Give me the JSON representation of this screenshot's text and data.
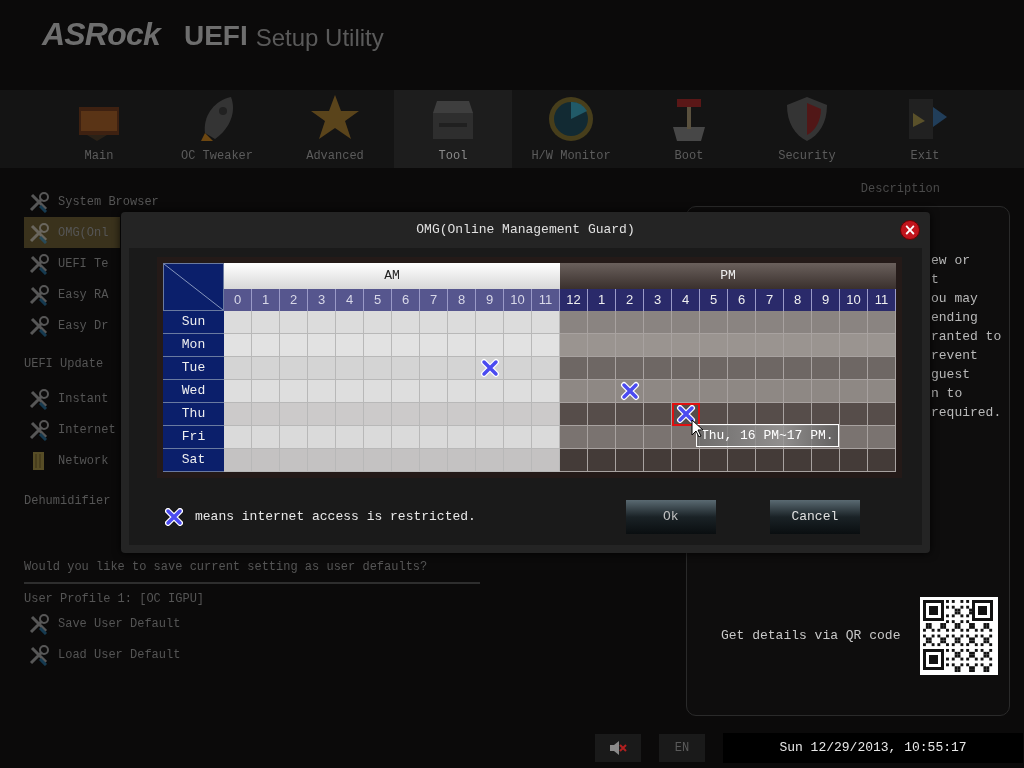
{
  "header": {
    "brand": "ASRock",
    "product": "UEFI",
    "subtitle": "Setup Utility"
  },
  "nav": [
    {
      "label": "Main",
      "kind": "main",
      "selected": false
    },
    {
      "label": "OC Tweaker",
      "kind": "oc",
      "selected": false
    },
    {
      "label": "Advanced",
      "kind": "advanced",
      "selected": false
    },
    {
      "label": "Tool",
      "kind": "tool",
      "selected": true
    },
    {
      "label": "H/W Monitor",
      "kind": "monitor",
      "selected": false
    },
    {
      "label": "Boot",
      "kind": "boot",
      "selected": false
    },
    {
      "label": "Security",
      "kind": "security",
      "selected": false
    },
    {
      "label": "Exit",
      "kind": "exit",
      "selected": false
    }
  ],
  "sidebar": {
    "items": [
      {
        "kind": "tool",
        "label": "System Browser",
        "selected": false
      },
      {
        "kind": "tool",
        "label": "OMG(Onl",
        "selected": true
      },
      {
        "kind": "tool",
        "label": "UEFI Te",
        "selected": false
      },
      {
        "kind": "tool",
        "label": "Easy RA",
        "selected": false
      },
      {
        "kind": "tool",
        "label": "Easy Dr",
        "selected": false
      },
      {
        "kind": "section",
        "label": "UEFI Update"
      },
      {
        "kind": "tool",
        "label": "Instant",
        "selected": false
      },
      {
        "kind": "tool",
        "label": "Internet",
        "selected": false
      },
      {
        "kind": "folder",
        "label": "Network",
        "selected": false
      },
      {
        "kind": "section",
        "label": "Dehumidifier"
      },
      {
        "kind": "question",
        "label": "Would you like to save current setting as user defaults?"
      },
      {
        "kind": "section",
        "label": "User Profile 1: [OC IGPU]"
      },
      {
        "kind": "tool",
        "label": "Save User Default",
        "selected": false
      },
      {
        "kind": "tool",
        "label": "Load User Default",
        "selected": false
      }
    ]
  },
  "description": {
    "title": "Description",
    "lines": [
      "ew or",
      "t",
      "ou may",
      "ending",
      "ranted to",
      "revent",
      "guest",
      "n to",
      "required."
    ],
    "qr_caption": "Get details via QR code"
  },
  "dialog": {
    "title": "OMG(Online Management Guard)",
    "close": "×",
    "am_label": "AM",
    "pm_label": "PM",
    "hours": [
      "0",
      "1",
      "2",
      "3",
      "4",
      "5",
      "6",
      "7",
      "8",
      "9",
      "10",
      "11",
      "12",
      "1",
      "2",
      "3",
      "4",
      "5",
      "6",
      "7",
      "8",
      "9",
      "10",
      "11"
    ],
    "rows": [
      {
        "day": "Sun",
        "restricted": [
          false,
          false,
          false,
          false,
          false,
          false,
          false,
          false,
          false,
          false,
          false,
          false,
          false,
          false,
          false,
          false,
          false,
          false,
          false,
          false,
          false,
          false,
          false,
          false
        ],
        "focused": [
          false,
          false,
          false,
          false,
          false,
          false,
          false,
          false,
          false,
          false,
          false,
          false,
          false,
          false,
          false,
          false,
          false,
          false,
          false,
          false,
          false,
          false,
          false,
          false
        ]
      },
      {
        "day": "Mon",
        "restricted": [
          false,
          false,
          false,
          false,
          false,
          false,
          false,
          false,
          false,
          false,
          false,
          false,
          false,
          false,
          false,
          false,
          false,
          false,
          false,
          false,
          false,
          false,
          false,
          false
        ],
        "focused": [
          false,
          false,
          false,
          false,
          false,
          false,
          false,
          false,
          false,
          false,
          false,
          false,
          false,
          false,
          false,
          false,
          false,
          false,
          false,
          false,
          false,
          false,
          false,
          false
        ]
      },
      {
        "day": "Tue",
        "restricted": [
          false,
          false,
          false,
          false,
          false,
          false,
          false,
          false,
          false,
          true,
          false,
          false,
          false,
          false,
          false,
          false,
          false,
          false,
          false,
          false,
          false,
          false,
          false,
          false
        ],
        "focused": [
          false,
          false,
          false,
          false,
          false,
          false,
          false,
          false,
          false,
          false,
          false,
          false,
          false,
          false,
          false,
          false,
          false,
          false,
          false,
          false,
          false,
          false,
          false,
          false
        ]
      },
      {
        "day": "Wed",
        "restricted": [
          false,
          false,
          false,
          false,
          false,
          false,
          false,
          false,
          false,
          false,
          false,
          false,
          false,
          false,
          true,
          false,
          false,
          false,
          false,
          false,
          false,
          false,
          false,
          false
        ],
        "focused": [
          false,
          false,
          false,
          false,
          false,
          false,
          false,
          false,
          false,
          false,
          false,
          false,
          false,
          false,
          false,
          false,
          false,
          false,
          false,
          false,
          false,
          false,
          false,
          false
        ]
      },
      {
        "day": "Thu",
        "restricted": [
          false,
          false,
          false,
          false,
          false,
          false,
          false,
          false,
          false,
          false,
          false,
          false,
          false,
          false,
          false,
          false,
          true,
          false,
          false,
          false,
          false,
          false,
          false,
          false
        ],
        "focused": [
          false,
          false,
          false,
          false,
          false,
          false,
          false,
          false,
          false,
          false,
          false,
          false,
          false,
          false,
          false,
          false,
          true,
          false,
          false,
          false,
          false,
          false,
          false,
          false
        ]
      },
      {
        "day": "Fri",
        "restricted": [
          false,
          false,
          false,
          false,
          false,
          false,
          false,
          false,
          false,
          false,
          false,
          false,
          false,
          false,
          false,
          false,
          false,
          false,
          false,
          false,
          false,
          false,
          false,
          false
        ],
        "focused": [
          false,
          false,
          false,
          false,
          false,
          false,
          false,
          false,
          false,
          false,
          false,
          false,
          false,
          false,
          false,
          false,
          false,
          false,
          false,
          false,
          false,
          false,
          false,
          false
        ]
      },
      {
        "day": "Sat",
        "restricted": [
          false,
          false,
          false,
          false,
          false,
          false,
          false,
          false,
          false,
          false,
          false,
          false,
          false,
          false,
          false,
          false,
          false,
          false,
          false,
          false,
          false,
          false,
          false,
          false
        ],
        "focused": [
          false,
          false,
          false,
          false,
          false,
          false,
          false,
          false,
          false,
          false,
          false,
          false,
          false,
          false,
          false,
          false,
          false,
          false,
          false,
          false,
          false,
          false,
          false,
          false
        ]
      }
    ],
    "tooltip": "Thu, 16 PM~17 PM.",
    "legend": "means internet access is restricted.",
    "buttons": [
      "Ok",
      "Cancel"
    ]
  },
  "status_bar": {
    "language": "EN",
    "datetime": "Sun 12/29/2013, 10:55:17"
  }
}
